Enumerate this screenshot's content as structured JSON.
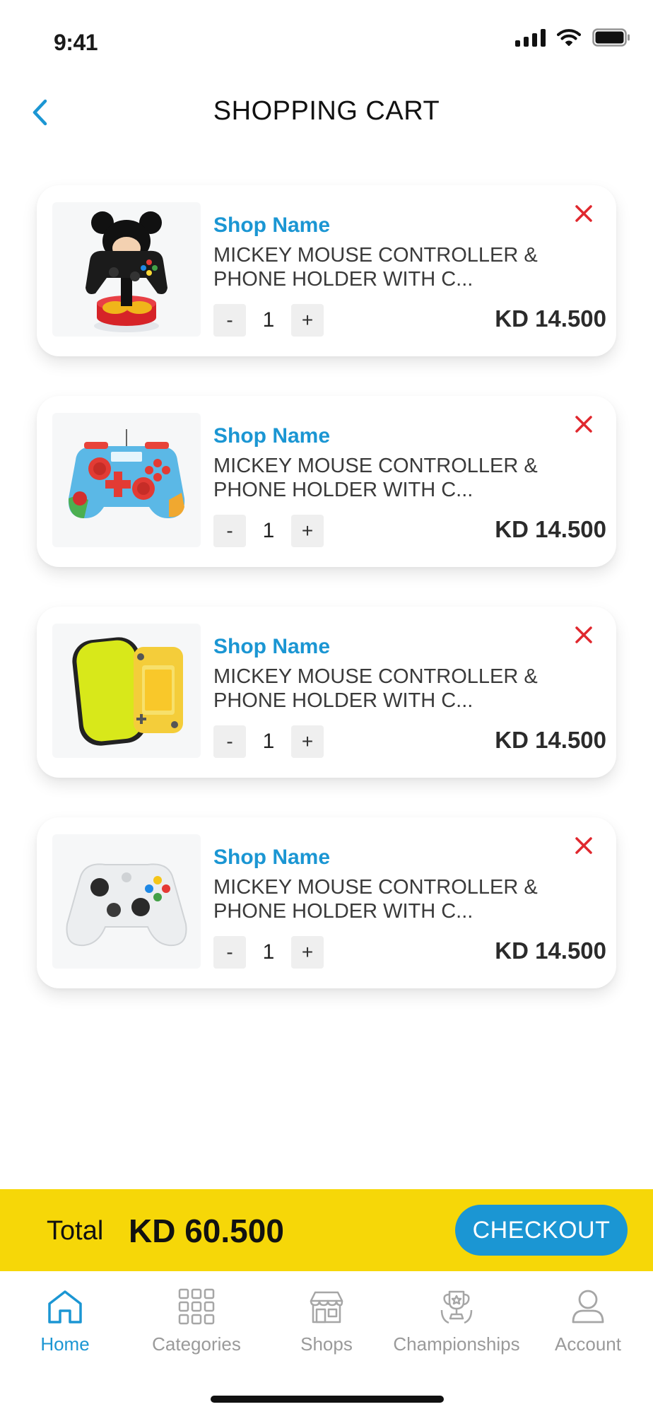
{
  "status_bar": {
    "time": "9:41"
  },
  "header": {
    "title": "SHOPPING CART",
    "back_icon": "chevron-left-icon"
  },
  "colors": {
    "accent": "#1b96d3",
    "total_bar": "#f6d708",
    "remove": "#e0282e"
  },
  "cart": {
    "items": [
      {
        "shop": "Shop Name",
        "name": "MICKEY MOUSE CONTROLLER & PHONE HOLDER WITH C...",
        "qty": "1",
        "price": "KD 14.500",
        "minus": "-",
        "plus": "+",
        "image": "mickey-controller-holder"
      },
      {
        "shop": "Shop Name",
        "name": "MICKEY MOUSE CONTROLLER & PHONE HOLDER WITH C...",
        "qty": "1",
        "price": "KD 14.500",
        "minus": "-",
        "plus": "+",
        "image": "mario-controller"
      },
      {
        "shop": "Shop Name",
        "name": "MICKEY MOUSE CONTROLLER & PHONE HOLDER WITH C...",
        "qty": "1",
        "price": "KD 14.500",
        "minus": "-",
        "plus": "+",
        "image": "switch-lite-case"
      },
      {
        "shop": "Shop Name",
        "name": "MICKEY MOUSE CONTROLLER & PHONE HOLDER WITH C...",
        "qty": "1",
        "price": "KD 14.500",
        "minus": "-",
        "plus": "+",
        "image": "xbox-controller"
      }
    ]
  },
  "total": {
    "label": "Total",
    "amount": "KD 60.500",
    "checkout": "CHECKOUT"
  },
  "nav": {
    "items": [
      {
        "label": "Home",
        "icon": "home-icon",
        "active": true
      },
      {
        "label": "Categories",
        "icon": "grid-icon",
        "active": false
      },
      {
        "label": "Shops",
        "icon": "shop-icon",
        "active": false
      },
      {
        "label": "Championships",
        "icon": "trophy-icon",
        "active": false
      },
      {
        "label": "Account",
        "icon": "user-icon",
        "active": false
      }
    ]
  }
}
